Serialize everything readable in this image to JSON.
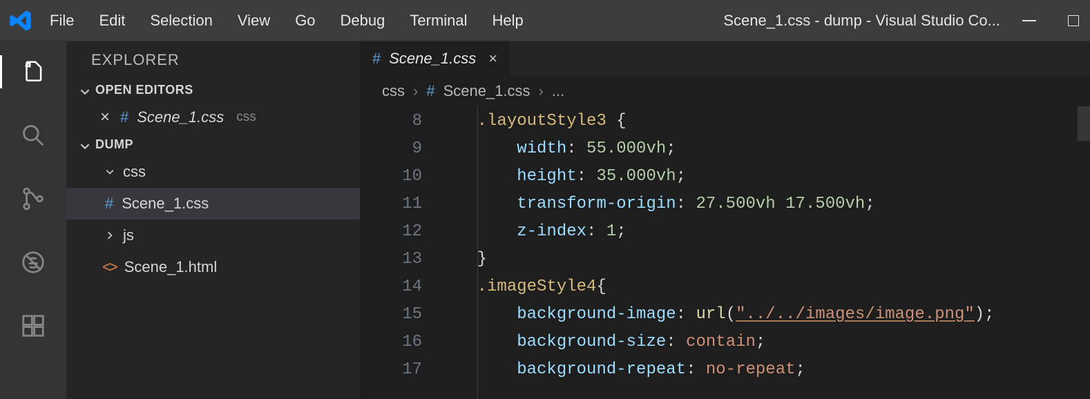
{
  "titlebar": {
    "menus": [
      "File",
      "Edit",
      "Selection",
      "View",
      "Go",
      "Debug",
      "Terminal",
      "Help"
    ],
    "title": "Scene_1.css - dump - Visual Studio Co..."
  },
  "sidebar": {
    "title": "EXPLORER",
    "sections": {
      "openEditors": {
        "label": "OPEN EDITORS",
        "items": [
          {
            "name": "Scene_1.css",
            "folderHint": "css",
            "dirty": false,
            "icon": "css"
          }
        ]
      },
      "workspace": {
        "label": "DUMP",
        "tree": [
          {
            "type": "folder",
            "name": "css",
            "expanded": true,
            "children": [
              {
                "type": "file",
                "name": "Scene_1.css",
                "icon": "css",
                "selected": true
              }
            ]
          },
          {
            "type": "folder",
            "name": "js",
            "expanded": false,
            "children": []
          },
          {
            "type": "file",
            "name": "Scene_1.html",
            "icon": "html"
          }
        ]
      }
    }
  },
  "editor": {
    "tab": {
      "name": "Scene_1.css",
      "icon": "css"
    },
    "breadcrumb": {
      "folder": "css",
      "file": "Scene_1.css",
      "trail": "..."
    },
    "startLine": 8,
    "lines": [
      {
        "n": 8,
        "tokens": [
          {
            "t": "ind",
            "v": 1
          },
          {
            "t": "sel",
            "v": ".layoutStyle3"
          },
          {
            "t": "sp"
          },
          {
            "t": "punc",
            "v": "{"
          }
        ]
      },
      {
        "n": 9,
        "tokens": [
          {
            "t": "ind",
            "v": 2
          },
          {
            "t": "prop",
            "v": "width"
          },
          {
            "t": "punc",
            "v": ":"
          },
          {
            "t": "sp"
          },
          {
            "t": "num",
            "v": "55.000vh"
          },
          {
            "t": "punc",
            "v": ";"
          }
        ]
      },
      {
        "n": 10,
        "tokens": [
          {
            "t": "ind",
            "v": 2
          },
          {
            "t": "prop",
            "v": "height"
          },
          {
            "t": "punc",
            "v": ":"
          },
          {
            "t": "sp"
          },
          {
            "t": "num",
            "v": "35.000vh"
          },
          {
            "t": "punc",
            "v": ";"
          }
        ]
      },
      {
        "n": 11,
        "tokens": [
          {
            "t": "ind",
            "v": 2
          },
          {
            "t": "prop",
            "v": "transform-origin"
          },
          {
            "t": "punc",
            "v": ":"
          },
          {
            "t": "sp"
          },
          {
            "t": "num",
            "v": "27.500vh"
          },
          {
            "t": "sp"
          },
          {
            "t": "num",
            "v": "17.500vh"
          },
          {
            "t": "punc",
            "v": ";"
          }
        ]
      },
      {
        "n": 12,
        "tokens": [
          {
            "t": "ind",
            "v": 2
          },
          {
            "t": "prop",
            "v": "z-index"
          },
          {
            "t": "punc",
            "v": ":"
          },
          {
            "t": "sp"
          },
          {
            "t": "num",
            "v": "1"
          },
          {
            "t": "punc",
            "v": ";"
          }
        ]
      },
      {
        "n": 13,
        "tokens": [
          {
            "t": "ind",
            "v": 1
          },
          {
            "t": "punc",
            "v": "}"
          }
        ]
      },
      {
        "n": 14,
        "tokens": [
          {
            "t": "ind",
            "v": 1
          },
          {
            "t": "sel",
            "v": ".imageStyle4"
          },
          {
            "t": "punc",
            "v": "{"
          }
        ]
      },
      {
        "n": 15,
        "tokens": [
          {
            "t": "ind",
            "v": 2
          },
          {
            "t": "prop",
            "v": "background-image"
          },
          {
            "t": "punc",
            "v": ":"
          },
          {
            "t": "sp"
          },
          {
            "t": "func",
            "v": "url"
          },
          {
            "t": "punc",
            "v": "("
          },
          {
            "t": "str",
            "v": "\"../../images/image.png\""
          },
          {
            "t": "punc",
            "v": ")"
          },
          {
            "t": "punc",
            "v": ";"
          }
        ]
      },
      {
        "n": 16,
        "tokens": [
          {
            "t": "ind",
            "v": 2
          },
          {
            "t": "prop",
            "v": "background-size"
          },
          {
            "t": "punc",
            "v": ":"
          },
          {
            "t": "sp"
          },
          {
            "t": "kw",
            "v": "contain"
          },
          {
            "t": "punc",
            "v": ";"
          }
        ]
      },
      {
        "n": 17,
        "tokens": [
          {
            "t": "ind",
            "v": 2
          },
          {
            "t": "prop",
            "v": "background-repeat"
          },
          {
            "t": "punc",
            "v": ":"
          },
          {
            "t": "sp"
          },
          {
            "t": "kw",
            "v": "no-repeat"
          },
          {
            "t": "punc",
            "v": ";"
          }
        ]
      }
    ]
  },
  "icons": {
    "hash": "#",
    "close": "×",
    "html": "<>"
  }
}
